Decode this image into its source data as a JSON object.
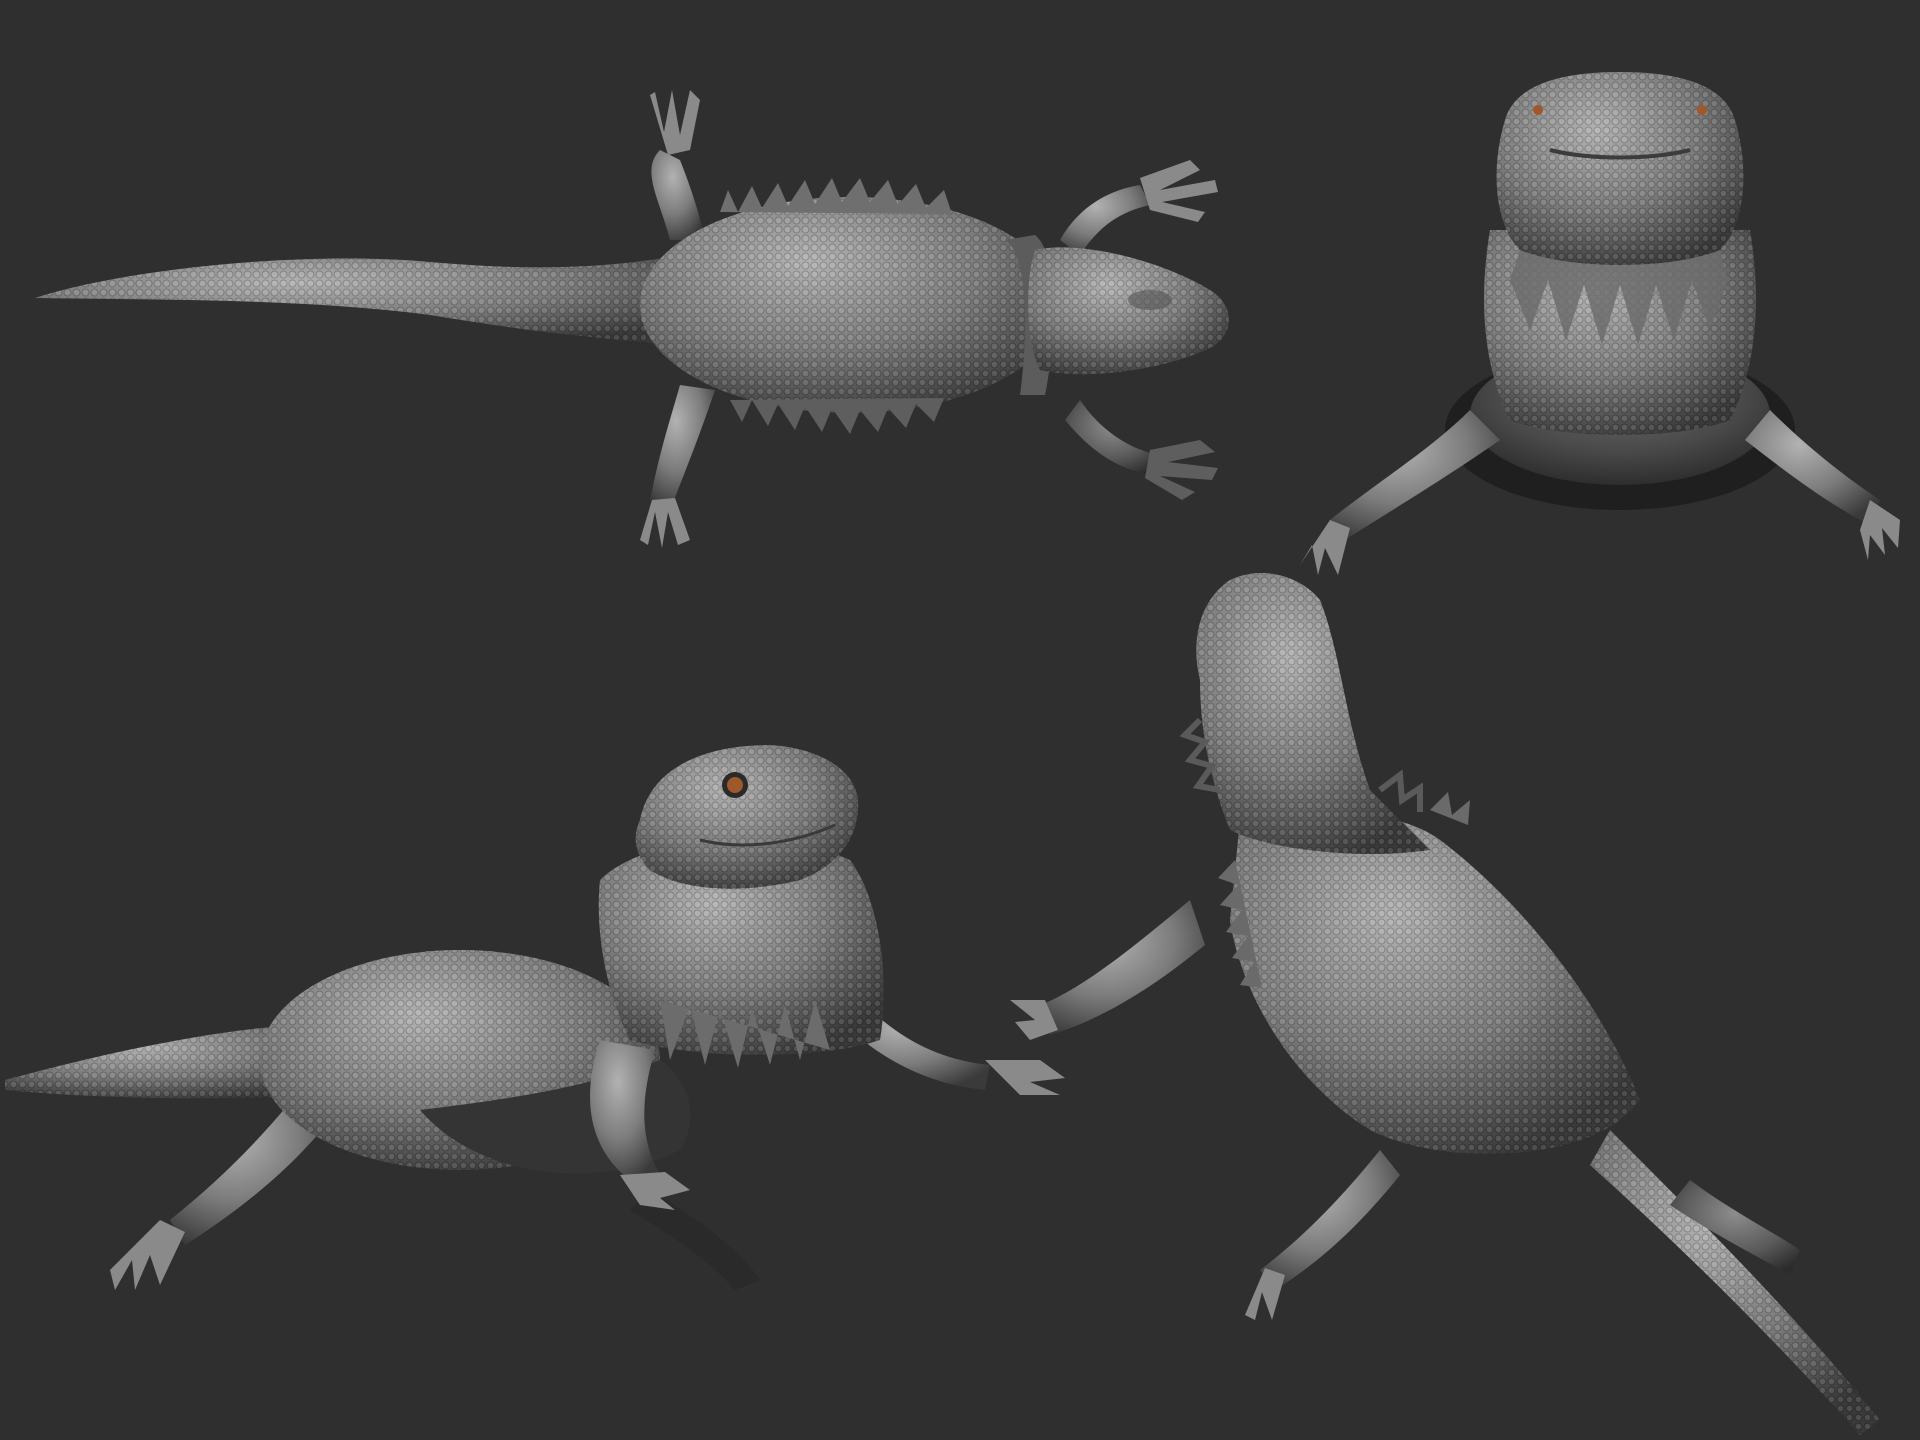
{
  "colors": {
    "background": "#2f2f30",
    "clay_light": "#a9a9a9",
    "clay_mid": "#7a7a7a",
    "clay_dark": "#3f3f3f",
    "shadow": "#1e1e1f",
    "eye": "#a0582a"
  },
  "views": [
    {
      "id": "top-view",
      "description_icon": "lizard-top-view"
    },
    {
      "id": "front-view",
      "description_icon": "lizard-front-view"
    },
    {
      "id": "three-quarter-view",
      "description_icon": "lizard-three-quarter-view"
    },
    {
      "id": "back-view",
      "description_icon": "lizard-back-view"
    }
  ]
}
